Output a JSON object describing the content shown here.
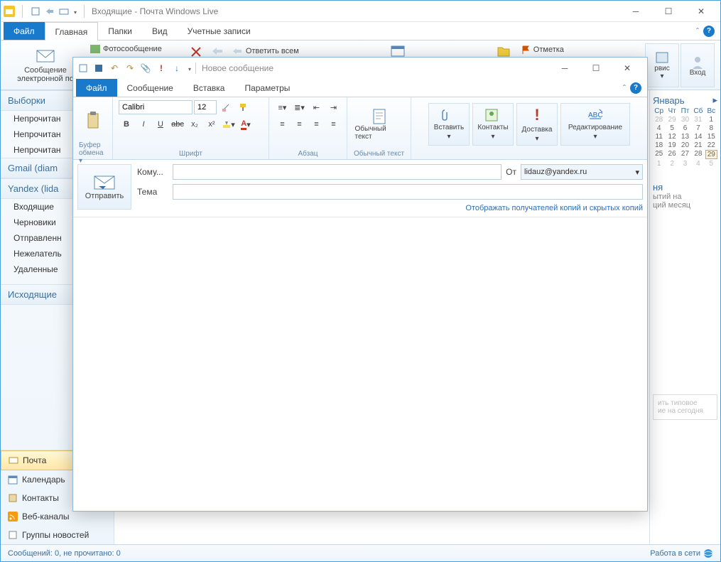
{
  "mainWindow": {
    "title": "Входящие - Почта Windows Live",
    "tabs": {
      "file": "Файл",
      "home": "Главная",
      "folders": "Папки",
      "view": "Вид",
      "accounts": "Учетные записи"
    },
    "ribbon": {
      "newMail": "Сообщение электронной по",
      "photoMail": "Фотосообщение",
      "replyAll": "Ответить всем",
      "flag": "Отметка",
      "service": "рвис",
      "login": "Вход"
    }
  },
  "sidebar": {
    "selections": "Выборки",
    "items1": [
      "Непрочитан",
      "Непрочитан",
      "Непрочитан"
    ],
    "gmail": "Gmail (diam",
    "yandex": "Yandex (lida",
    "ylist": [
      "Входящие",
      "Черновики",
      "Отправленн",
      "Нежелатель",
      "Удаленные"
    ],
    "outgoing": "Исходящие",
    "bottom": {
      "mail": "Почта",
      "calendar": "Календарь",
      "contacts": "Контакты",
      "feeds": "Веб-каналы",
      "newsgroups": "Группы новостей"
    }
  },
  "calendar": {
    "month": "Январь",
    "dow": [
      "Ср",
      "Чт",
      "Пт",
      "Сб",
      "Вс"
    ],
    "rows": [
      [
        "28",
        "29",
        "30",
        "31",
        "1"
      ],
      [
        "4",
        "5",
        "6",
        "7",
        "8"
      ],
      [
        "11",
        "12",
        "13",
        "14",
        "15"
      ],
      [
        "18",
        "19",
        "20",
        "21",
        "22"
      ],
      [
        "25",
        "26",
        "27",
        "28",
        "29"
      ],
      [
        "1",
        "2",
        "3",
        "4",
        "5"
      ]
    ],
    "eventHead": "ня",
    "eventL1": "ытий на",
    "eventL2": "ций месяц",
    "hint1": "ить типовое",
    "hint2": "ие на сегодня"
  },
  "status": {
    "left": "Сообщений: 0, не прочитано: 0",
    "right": "Работа в сети"
  },
  "compose": {
    "title": "Новое сообщение",
    "tabs": {
      "file": "Файл",
      "message": "Сообщение",
      "insert": "Вставка",
      "options": "Параметры"
    },
    "groups": {
      "clipboard": "Буфер обмена",
      "font": "Шрифт",
      "paragraph": "Абзац",
      "plaintext": "Обычный текст",
      "plaintextBtn": "Обычный текст",
      "insert": "Вставить",
      "contacts": "Контакты",
      "delivery": "Доставка",
      "editing": "Редактирование"
    },
    "fontName": "Calibri",
    "fontSize": "12",
    "send": "Отправить",
    "toLabel": "Кому...",
    "subjectLabel": "Тема",
    "fromLabel": "От",
    "fromValue": "lidauz@yandex.ru",
    "ccLink": "Отображать получателей копий и скрытых копий"
  }
}
